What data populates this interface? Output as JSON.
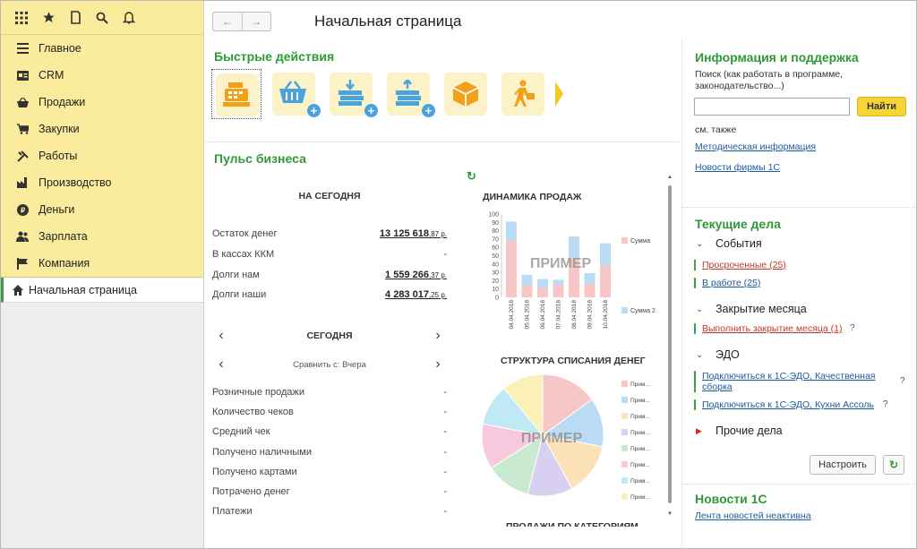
{
  "sidebar": {
    "toolbar_icons": [
      "apps-grid-icon",
      "star-icon",
      "history-icon",
      "search-icon",
      "bell-icon"
    ],
    "items": [
      {
        "label": "Главное",
        "icon": "menu-lines-icon"
      },
      {
        "label": "CRM",
        "icon": "card-icon"
      },
      {
        "label": "Продажи",
        "icon": "basket-icon"
      },
      {
        "label": "Закупки",
        "icon": "cart-icon"
      },
      {
        "label": "Работы",
        "icon": "tools-icon"
      },
      {
        "label": "Производство",
        "icon": "factory-icon"
      },
      {
        "label": "Деньги",
        "icon": "coin-icon"
      },
      {
        "label": "Зарплата",
        "icon": "people-icon"
      },
      {
        "label": "Компания",
        "icon": "flag-icon"
      }
    ],
    "open_page": "Начальная страница"
  },
  "header": {
    "title": "Начальная страница"
  },
  "quick_actions": {
    "title": "Быстрые действия",
    "buttons": [
      "cash-register-icon",
      "basket-add-icon",
      "money-in-add-icon",
      "money-out-add-icon",
      "box-icon",
      "courier-icon"
    ]
  },
  "pulse": {
    "title": "Пульс бизнеса",
    "today_head": "НА СЕГОДНЯ",
    "rows": [
      {
        "label": "Остаток денег",
        "value": "13 125 618",
        "cents": ",87 р."
      },
      {
        "label": "В кассах ККМ",
        "value": "-",
        "cents": ""
      },
      {
        "label": "Долги нам",
        "value": "1 559 266",
        "cents": ",37 р."
      },
      {
        "label": "Долги наши",
        "value": "4 283 017",
        "cents": ",25 р."
      }
    ],
    "period": "СЕГОДНЯ",
    "compare": "Сравнить с: Вчера",
    "metrics": [
      {
        "label": "Розничные продажи",
        "value": "-"
      },
      {
        "label": "Количество чеков",
        "value": "-"
      },
      {
        "label": "Средний чек",
        "value": "-"
      },
      {
        "label": "Получено наличными",
        "value": "-"
      },
      {
        "label": "Получено картами",
        "value": "-"
      },
      {
        "label": "Потрачено денег",
        "value": "-"
      },
      {
        "label": "Платежи",
        "value": "-"
      }
    ]
  },
  "chart_data": [
    {
      "type": "bar",
      "title": "ДИНАМИКА ПРОДАЖ",
      "categories": [
        "04.04.2018",
        "05.04.2018",
        "06.04.2018",
        "07.04.2018",
        "08.04.2018",
        "09.04.2018",
        "10.04.2018"
      ],
      "series": [
        {
          "name": "Сумма",
          "color": "#f7c6c6",
          "values": [
            68,
            14,
            12,
            15,
            48,
            16,
            38
          ]
        },
        {
          "name": "Сумма 2",
          "color": "#bcdcf5",
          "values": [
            23,
            13,
            10,
            6,
            25,
            13,
            27
          ]
        }
      ],
      "ylim": [
        0,
        100
      ],
      "yticks": [
        0,
        10,
        20,
        30,
        40,
        50,
        60,
        70,
        80,
        90,
        100
      ],
      "watermark": "ПРИМЕР",
      "stacked": true
    },
    {
      "type": "pie",
      "title": "СТРУКТУРА СПИСАНИЯ ДЕНЕГ",
      "watermark": "ПРИМЕР",
      "legend_label": "Прим...",
      "slices": [
        {
          "value": 15,
          "color": "#f7c6c6"
        },
        {
          "value": 13,
          "color": "#bcdcf5"
        },
        {
          "value": 14,
          "color": "#fde1b8"
        },
        {
          "value": 12,
          "color": "#d9cff0"
        },
        {
          "value": 12,
          "color": "#c9ead0"
        },
        {
          "value": 12,
          "color": "#f8c8dc"
        },
        {
          "value": 11,
          "color": "#bfe9f4"
        },
        {
          "value": 11,
          "color": "#fbf0b6"
        }
      ]
    }
  ],
  "next_chart_title": "ПРОДАЖИ ПО КАТЕГОРИЯМ",
  "info": {
    "title": "Информация и поддержка",
    "search_hint": "Поиск (как работать в программе, законодательство...)",
    "search_value": "",
    "find_label": "Найти",
    "see_also": "см. также",
    "links": [
      "Методическая информация",
      "Новости фирмы 1С"
    ]
  },
  "tasks": {
    "title": "Текущие дела",
    "events": "События",
    "overdue": "Просроченные (25)",
    "in_work": "В работе (25)",
    "closing": "Закрытие месяца",
    "do_closing": "Выполнить закрытие месяца (1)",
    "edo": "ЭДО",
    "edo_link1": "Подключиться к 1С-ЭДО, Качественная сборка",
    "edo_link2": "Подключиться к 1С-ЭДО, Кухни Ассоль",
    "other": "Прочие дела",
    "question": "?",
    "setup_label": "Настроить"
  },
  "news": {
    "title": "Новости 1С",
    "link": "Лента новостей неактивна"
  }
}
